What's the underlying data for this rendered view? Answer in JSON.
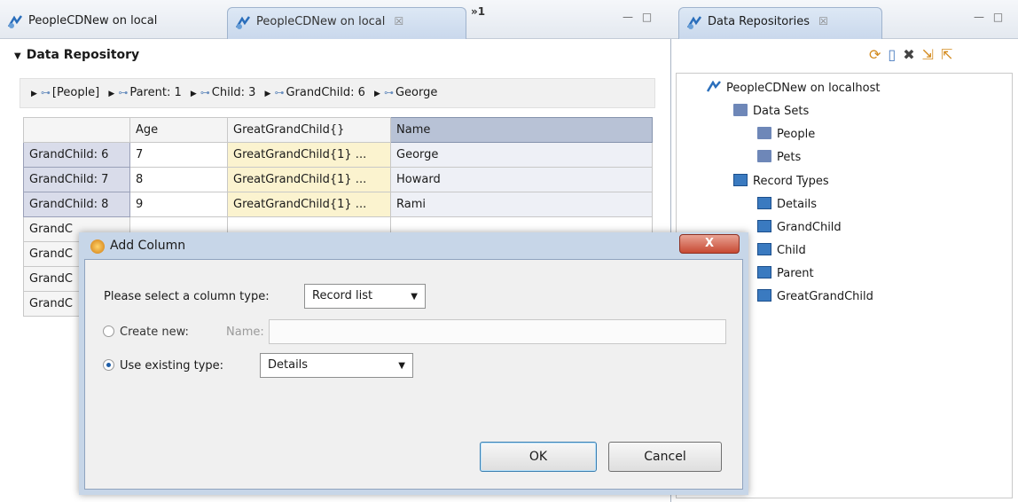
{
  "editor": {
    "tabs": [
      {
        "label": "PeopleCDNew on local"
      },
      {
        "label": "PeopleCDNew on local",
        "close": "☒"
      }
    ],
    "overflow": "»1",
    "window_controls": "— □",
    "section_title": "Data Repository",
    "breadcrumbs": [
      "[People]",
      "Parent: 1",
      "Child: 3",
      "GrandChild: 6",
      "George"
    ],
    "grid": {
      "headers": [
        "Age",
        "GreatGrandChild{}",
        "Name"
      ],
      "rows": [
        {
          "head": "GrandChild: 6",
          "age": "7",
          "ggc": "GreatGrandChild{1} ...",
          "name": "George"
        },
        {
          "head": "GrandChild: 7",
          "age": "8",
          "ggc": "GreatGrandChild{1} ...",
          "name": "Howard"
        },
        {
          "head": "GrandChild: 8",
          "age": "9",
          "ggc": "GreatGrandChild{1} ...",
          "name": "Rami"
        },
        {
          "head": "GrandC",
          "age": "",
          "ggc": "",
          "name": ""
        },
        {
          "head": "GrandC",
          "age": "",
          "ggc": "",
          "name": ""
        },
        {
          "head": "GrandC",
          "age": "",
          "ggc": "",
          "name": ""
        },
        {
          "head": "GrandC",
          "age": "",
          "ggc": "",
          "name": ""
        }
      ]
    }
  },
  "repositories": {
    "tab_label": "Data Repositories",
    "tab_close": "☒",
    "window_controls": "— □",
    "toolbar_icons": [
      "refresh-icon",
      "new-icon",
      "delete-icon",
      "import-icon",
      "export-icon"
    ],
    "tree": {
      "root": "PeopleCDNew on localhost",
      "data_sets_label": "Data Sets",
      "data_sets": [
        "People",
        "Pets"
      ],
      "record_types_label": "Record Types",
      "record_types": [
        "Details",
        "GrandChild",
        "Child",
        "Parent",
        "GreatGrandChild"
      ]
    }
  },
  "dialog": {
    "title": "Add Column",
    "close_label": "X",
    "column_type_label": "Please select a column type:",
    "column_type_value": "Record list",
    "create_new_label": "Create new:",
    "name_label": "Name:",
    "name_value": "",
    "use_existing_label": "Use existing type:",
    "use_existing_value": "Details",
    "ok_label": "OK",
    "cancel_label": "Cancel"
  }
}
